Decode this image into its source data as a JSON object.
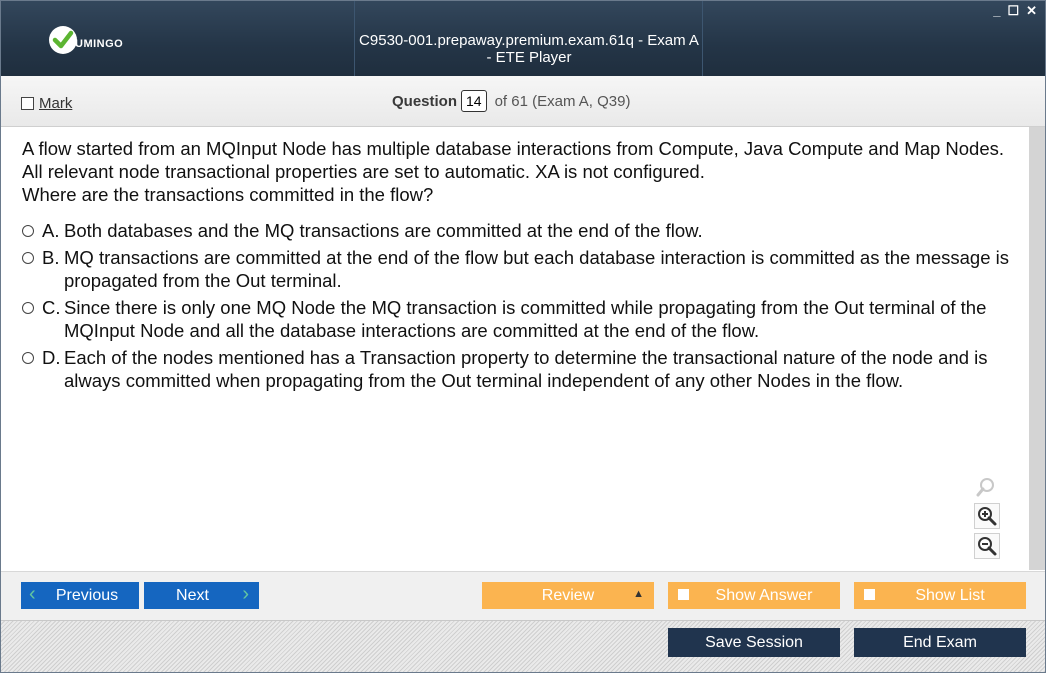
{
  "window": {
    "title": "C9530-001.prepaway.premium.exam.61q - Exam A - ETE Player",
    "logo_text": "UMINGO",
    "controls": [
      "_",
      "☐",
      "✕"
    ]
  },
  "header": {
    "mark_label": "Mark",
    "question_label": "Question",
    "question_number": "14",
    "question_of": "of 61 (Exam A, Q39)"
  },
  "question": {
    "lines": [
      "A flow started from an MQInput Node has multiple database interactions from Compute, Java Compute and Map Nodes. All relevant node transactional properties are set to automatic. XA is not configured.",
      "Where are the transactions committed in the flow?"
    ],
    "options": [
      {
        "letter": "A.",
        "text": "Both databases and the MQ transactions are committed at the end of the flow."
      },
      {
        "letter": "B.",
        "text": "MQ transactions are committed at the end of the flow but each database interaction is committed as the message is propagated from the Out terminal."
      },
      {
        "letter": "C.",
        "text": "Since there is only one MQ Node the MQ transaction is committed while propagating from the Out terminal of the MQInput Node and all the database interactions are committed at the end of the flow."
      },
      {
        "letter": "D.",
        "text": "Each of the nodes mentioned has a Transaction property to determine the transactional nature of the node and is always committed when propagating from the Out terminal independent of any other Nodes in the flow."
      }
    ]
  },
  "zoom": {
    "icons": [
      "zoom-reset-icon",
      "zoom-in-icon",
      "zoom-out-icon"
    ]
  },
  "buttons": {
    "previous": "Previous",
    "next": "Next",
    "review": "Review",
    "show_answer": "Show Answer",
    "show_list": "Show List",
    "save_session": "Save Session",
    "end_exam": "End Exam"
  },
  "colors": {
    "titlebar": "#243547",
    "nav_blue": "#1566c0",
    "orange": "#fbb450",
    "dark_button": "#20344e",
    "logo_green": "#5cb531"
  }
}
